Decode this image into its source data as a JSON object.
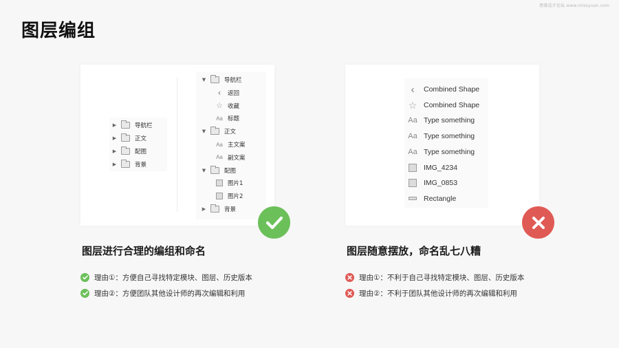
{
  "watermark": "思缘设计论坛 www.missyuan.com",
  "page_title": "图层编组",
  "colors": {
    "good": "#6cc05a",
    "bad": "#e05a55",
    "background": "#f7f7f7"
  },
  "good_example": {
    "collapsed_layers": [
      {
        "type": "folder",
        "label": "导航栏",
        "state": "collapsed"
      },
      {
        "type": "folder",
        "label": "正文",
        "state": "collapsed"
      },
      {
        "type": "folder",
        "label": "配图",
        "state": "collapsed"
      },
      {
        "type": "folder",
        "label": "背景",
        "state": "collapsed"
      }
    ],
    "expanded_layers": [
      {
        "type": "folder",
        "label": "导航栏",
        "state": "expanded",
        "level": 0
      },
      {
        "type": "shape-chevron",
        "label": "返回",
        "level": 1
      },
      {
        "type": "shape-star",
        "label": "收藏",
        "level": 1
      },
      {
        "type": "text",
        "icon": "Aa",
        "label": "标题",
        "level": 1
      },
      {
        "type": "folder",
        "label": "正文",
        "state": "expanded",
        "level": 0
      },
      {
        "type": "text",
        "icon": "Aa",
        "label": "主文案",
        "level": 1
      },
      {
        "type": "text",
        "icon": "Aa",
        "label": "副文案",
        "level": 1
      },
      {
        "type": "folder",
        "label": "配图",
        "state": "expanded",
        "level": 0
      },
      {
        "type": "image",
        "label": "图片1",
        "level": 1
      },
      {
        "type": "image",
        "label": "图片2",
        "level": 1
      },
      {
        "type": "folder",
        "label": "背景",
        "state": "collapsed",
        "level": 0
      }
    ],
    "caption": "图层进行合理的编组和命名",
    "reasons": [
      "理由①：方便自己寻找特定模块、图层、历史版本",
      "理由②：方便团队其他设计师的再次编辑和利用"
    ],
    "badge_icon": "check-icon"
  },
  "bad_example": {
    "layers": [
      {
        "type": "shape-chevron",
        "label": "Combined Shape"
      },
      {
        "type": "shape-star",
        "label": "Combined Shape"
      },
      {
        "type": "text",
        "icon": "Aa",
        "label": "Type something"
      },
      {
        "type": "text",
        "icon": "Aa",
        "label": "Type something"
      },
      {
        "type": "text",
        "icon": "Aa",
        "label": "Type something"
      },
      {
        "type": "image",
        "label": "IMG_4234"
      },
      {
        "type": "image",
        "label": "IMG_0853"
      },
      {
        "type": "rectangle",
        "label": "Rectangle"
      }
    ],
    "caption": "图层随意摆放，命名乱七八糟",
    "reasons": [
      "理由①：不利于自己寻找特定模块、图层、历史版本",
      "理由②：不利于团队其他设计师的再次编辑和利用"
    ],
    "badge_icon": "cross-icon"
  },
  "icons": {
    "caret_collapsed": "▶",
    "caret_expanded": "▼",
    "chevron": "‹",
    "star": "☆",
    "text": "Aa"
  }
}
